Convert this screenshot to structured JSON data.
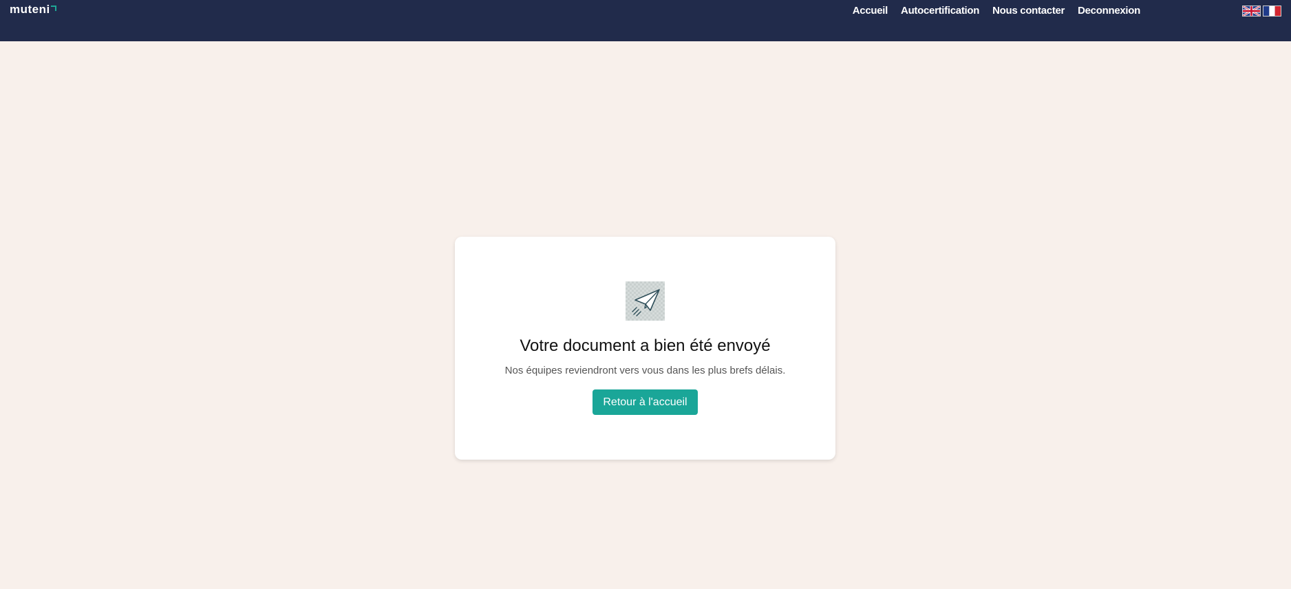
{
  "brand": {
    "name": "muteni",
    "accent": "#1ea896"
  },
  "nav": {
    "items": [
      {
        "label": "Accueil"
      },
      {
        "label": "Autocertification"
      },
      {
        "label": "Nous contacter"
      },
      {
        "label": "Deconnexion"
      }
    ]
  },
  "languages": [
    "english-flag-icon",
    "french-flag-icon"
  ],
  "colors": {
    "topbar": "#212b4b",
    "background": "#f8f0eb",
    "button": "#1aa698"
  },
  "confirmation": {
    "icon": "paper-plane-icon",
    "title": "Votre document a bien été envoyé",
    "message": "Nos équipes reviendront vers vous dans les plus brefs délais.",
    "button_label": "Retour à l'accueil"
  }
}
